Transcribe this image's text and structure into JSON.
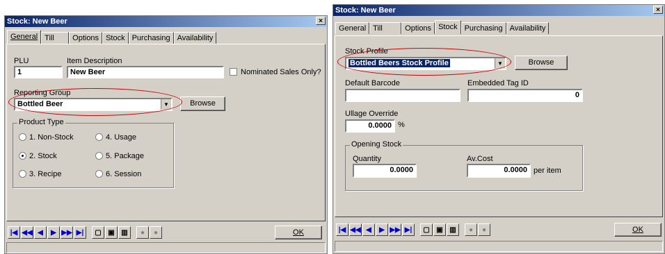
{
  "left": {
    "title": "Stock: New Beer",
    "close": "×",
    "tabs": [
      "General",
      "Till",
      "Options",
      "Stock",
      "Purchasing",
      "Availability"
    ],
    "plu_label": "PLU",
    "plu_value": "1",
    "desc_label": "Item Description",
    "desc_value": "New Beer",
    "nominated_label": "Nominated Sales Only?",
    "reporting_group_label": "Reporting Group",
    "reporting_group_value": "Bottled Beer",
    "browse_label": "Browse",
    "product_type_label": "Product Type",
    "radios": [
      "1. Non-Stock",
      "4. Usage",
      "2. Stock",
      "5. Package",
      "3. Recipe",
      "6. Session"
    ],
    "ok_label": "OK"
  },
  "right": {
    "title": "Stock: New Beer",
    "close": "×",
    "tabs": [
      "General",
      "Till",
      "Options",
      "Stock",
      "Purchasing",
      "Availability"
    ],
    "stock_profile_label": "Stock Profile",
    "stock_profile_value": "Bottled Beers Stock Profile",
    "browse_label": "Browse",
    "default_barcode_label": "Default Barcode",
    "default_barcode_value": "",
    "embedded_tag_label": "Embedded Tag ID",
    "embedded_tag_value": "0",
    "ullage_label": "Ullage Override",
    "ullage_value": "0.0000",
    "ullage_unit": "%",
    "opening_stock_label": "Opening Stock",
    "quantity_label": "Quantity",
    "quantity_value": "0.0000",
    "avcost_label": "Av.Cost",
    "avcost_value": "0.0000",
    "per_item": "per item",
    "ok_label": "OK"
  },
  "colors": {
    "title_start": "#0a246a",
    "title_end": "#a6caf0",
    "highlight_ellipse": "#d00000"
  }
}
